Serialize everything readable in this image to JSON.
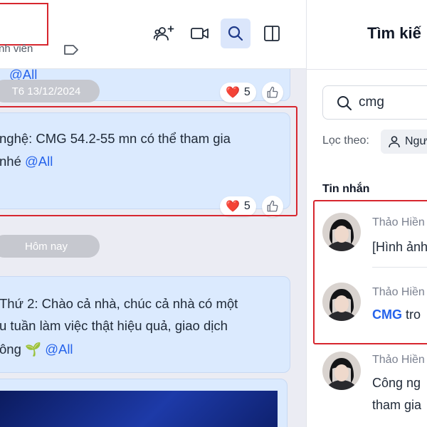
{
  "chat": {
    "header": {
      "member_label": "nh viên",
      "icons": [
        "add-member-icon",
        "video-call-icon",
        "search-icon",
        "panel-toggle-icon",
        "tag-icon"
      ]
    },
    "messages": [
      {
        "mention": "@All"
      },
      {
        "line1": "nghệ: CMG 54.2-55 mn có thể tham gia",
        "line2_prefix": "nhé ",
        "mention": "@All",
        "reaction_count": "5"
      },
      {
        "line1": "Thứ 2: Chào cả nhà, chúc cả nhà có một",
        "line2": "u tuần làm việc thật hiệu quả, giao dịch",
        "line3_prefix": "ông ",
        "emoji": "🌱",
        "mention": "@All"
      }
    ],
    "first_reaction_count": "5",
    "date_separators": [
      "T6 13/12/2024",
      "Hôm nay"
    ]
  },
  "search": {
    "title": "Tìm kiế",
    "query": "cmg",
    "filter_label": "Lọc theo:",
    "filter_chip": "Ngư",
    "section_label": "Tin nhắn",
    "results": [
      {
        "name": "Thảo Hiền",
        "snippet": "[Hình ảnh"
      },
      {
        "name": "Thảo Hiền",
        "snippet_highlight": "CMG",
        "snippet_rest": " tro"
      },
      {
        "name": "Thảo Hiền",
        "snippet": "Công ng",
        "snippet2": "tham gia"
      }
    ]
  },
  "colors": {
    "highlight_border": "#d7262e",
    "accent": "#2563eb",
    "bubble": "#dbeafe",
    "chat_bg": "#ebecf3"
  }
}
